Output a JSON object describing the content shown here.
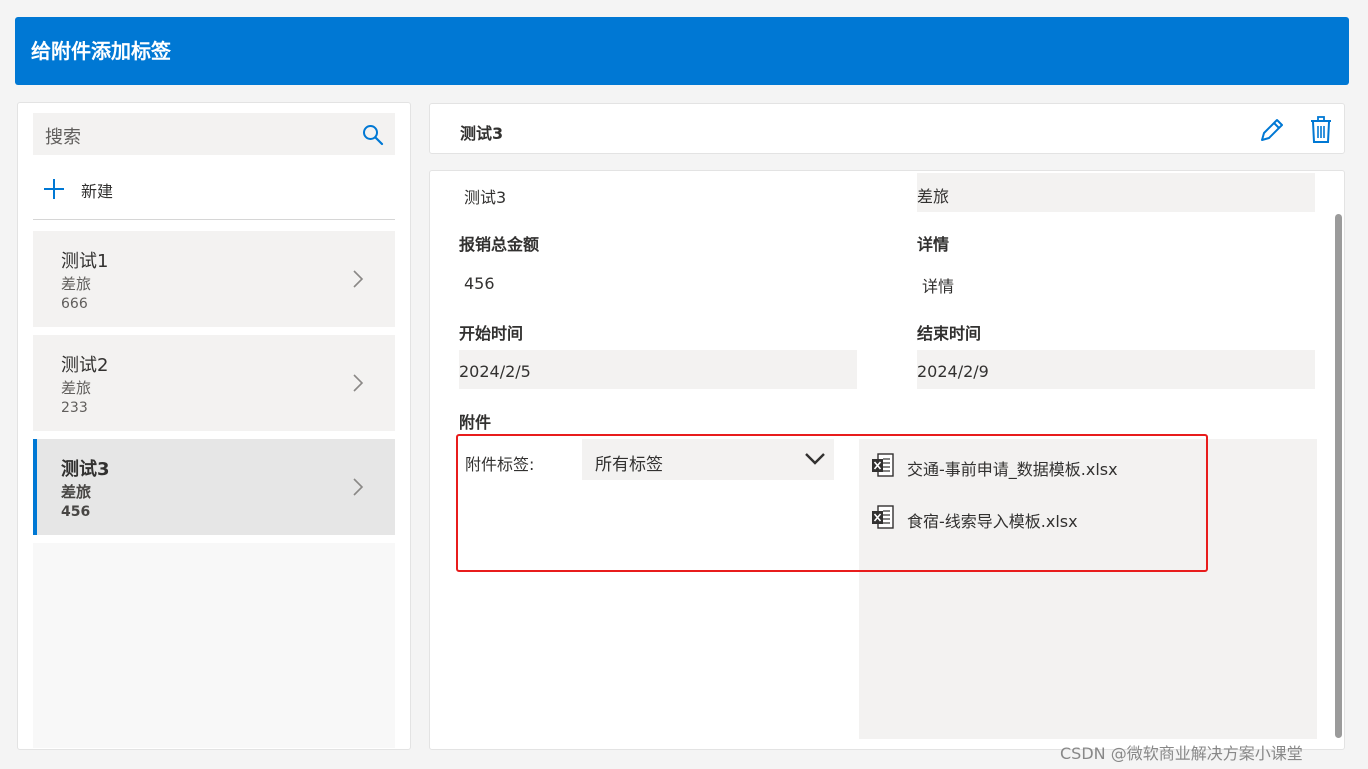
{
  "header": {
    "title": "给附件添加标签"
  },
  "sidebar": {
    "search_placeholder": "搜索",
    "new_label": "新建",
    "items": [
      {
        "title": "测试1",
        "category": "差旅",
        "amount": "666",
        "selected": false
      },
      {
        "title": "测试2",
        "category": "差旅",
        "amount": "233",
        "selected": false
      },
      {
        "title": "测试3",
        "category": "差旅",
        "amount": "456",
        "selected": true
      }
    ]
  },
  "detail": {
    "title": "测试3",
    "name_value": "测试3",
    "type_value": "差旅",
    "total_label": "报销总金额",
    "total_value": "456",
    "details_label": "详情",
    "details_value": "详情",
    "start_label": "开始时间",
    "start_value": "2024/2/5",
    "end_label": "结束时间",
    "end_value": "2024/2/9",
    "attachments_label": "附件",
    "tag_label": "附件标签:",
    "tag_selected": "所有标签",
    "files": [
      "交通-事前申请_数据模板.xlsx",
      "食宿-线索导入模板.xlsx"
    ]
  },
  "icons": {
    "search": "search-icon",
    "add": "plus-icon",
    "chevron": "chevron-right-icon",
    "edit": "pencil-icon",
    "delete": "trash-icon",
    "dropdown": "chevron-down-icon",
    "excel": "excel-file-icon"
  },
  "colors": {
    "accent": "#0078d4",
    "highlight_box": "#e81c1c"
  },
  "watermark": "CSDN @微软商业解决方案小课堂"
}
